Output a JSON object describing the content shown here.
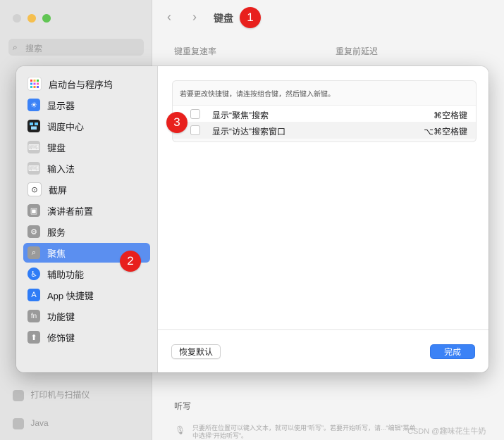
{
  "background": {
    "search_placeholder": "搜索",
    "title": "键盘",
    "key_repeat_label": "键重复速率",
    "repeat_delay_label": "重复前延迟",
    "dictation_label": "听写",
    "dictation_note": "只要所在位置可以键入文本，就可以使用“听写”。若要开始听写，请...“编辑”菜单中选择“开始听写”。",
    "sidebar_items": [
      "打印机与扫描仪",
      "Java"
    ],
    "watermark": "CSDN @趣味花生牛奶"
  },
  "badges": [
    "1",
    "2",
    "3"
  ],
  "sheet": {
    "sidebar": [
      {
        "label": "启动台与程序坞",
        "icon": "launchpad-icon",
        "color": "#ffffff"
      },
      {
        "label": "显示器",
        "icon": "display-icon",
        "color": "#3b82f6"
      },
      {
        "label": "调度中心",
        "icon": "mission-control-icon",
        "color": "#222222"
      },
      {
        "label": "键盘",
        "icon": "keyboard-icon",
        "color": "#bdbdbd"
      },
      {
        "label": "输入法",
        "icon": "input-method-icon",
        "color": "#bdbdbd"
      },
      {
        "label": "截屏",
        "icon": "screenshot-icon",
        "color": "#ffffff"
      },
      {
        "label": "演讲者前置",
        "icon": "presenter-icon",
        "color": "#9a9a9a"
      },
      {
        "label": "服务",
        "icon": "services-icon",
        "color": "#9a9a9a"
      },
      {
        "label": "聚焦",
        "icon": "spotlight-icon",
        "color": "#9a9a9a",
        "selected": true
      },
      {
        "label": "辅助功能",
        "icon": "accessibility-icon",
        "color": "#2f7cf6"
      },
      {
        "label": "App 快捷键",
        "icon": "app-shortcuts-icon",
        "color": "#2f7cf6"
      },
      {
        "label": "功能键",
        "icon": "fn-icon",
        "color": "#9a9a9a"
      },
      {
        "label": "修饰键",
        "icon": "modifier-icon",
        "color": "#9a9a9a"
      }
    ],
    "hint": "若要更改快捷键，请连按组合键，然后键入新键。",
    "shortcuts": [
      {
        "label": "显示“聚焦”搜索",
        "key": "⌘空格键",
        "checked": false
      },
      {
        "label": "显示“访达”搜索窗口",
        "key": "⌥⌘空格键",
        "checked": false
      }
    ],
    "reset_button": "恢复默认",
    "done_button": "完成"
  }
}
